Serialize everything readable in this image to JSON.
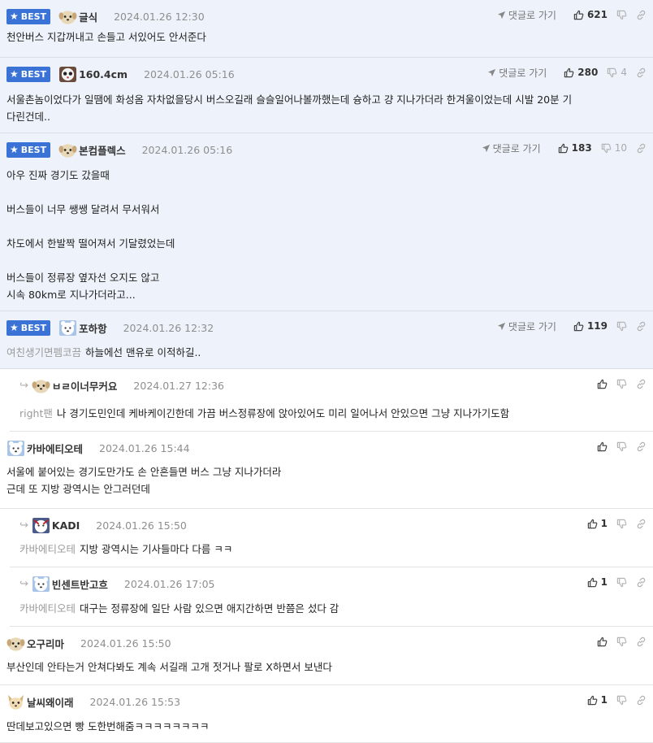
{
  "labels": {
    "best": "BEST",
    "reply_to": "댓글로 가기"
  },
  "comments": [
    {
      "nick": "글식",
      "date": "2024.01.26 12:30",
      "likes": "621",
      "dislikes": "",
      "mention": "",
      "lines": [
        "천안버스 지갑꺼내고 손들고 서있어도 안서준다"
      ]
    },
    {
      "nick": "160.4cm",
      "date": "2024.01.26 05:16",
      "likes": "280",
      "dislikes": "4",
      "mention": "",
      "lines": [
        "서울촌놈이었다가 일땜에 화성옴 자차없을당시 버스오길래 슬슬일어나볼까했는데 슝하고 걍 지나가더라 한겨울이었는데 시발 20분 기",
        "다린건데.."
      ]
    },
    {
      "nick": "본컴플렉스",
      "date": "2024.01.26 05:16",
      "likes": "183",
      "dislikes": "10",
      "mention": "",
      "lines": [
        "아우 진짜 경기도 갔을때",
        "",
        "버스들이 너무 쌩쌩 달려서 무서워서",
        "",
        "차도에서 한발짝 떨어져서 기달렸었는데",
        "",
        "버스들이 정류장 옆자선 오지도 않고",
        "시속 80km로 지나가더라고..."
      ]
    },
    {
      "nick": "포하항",
      "date": "2024.01.26 12:32",
      "likes": "119",
      "dislikes": "",
      "mention": "여친생기면펨코끔",
      "lines": [
        "하늘에선 맨유로 이적하길.."
      ]
    },
    {
      "nick": "ㅂㄹ이너무커요",
      "date": "2024.01.27 12:36",
      "likes": "",
      "dislikes": "",
      "mention": "right팬",
      "lines": [
        "나 경기도민인데 케바케이긴한데 가끔 버스정류장에 앉아있어도 미리 일어나서 안있으면 그냥 지나가기도함"
      ]
    },
    {
      "nick": "카바에티오테",
      "date": "2024.01.26 15:44",
      "likes": "",
      "dislikes": "",
      "mention": "",
      "lines": [
        "서울에 붙어있는 경기도만가도 손 안흔들면 버스 그냥 지나가더라",
        "근데 또 지방 광역시는 안그러던데"
      ]
    },
    {
      "nick": "KADI",
      "date": "2024.01.26 15:50",
      "likes": "1",
      "dislikes": "",
      "mention": "카바에티오테",
      "lines": [
        "지방 광역시는 기사들마다 다름 ㅋㅋ"
      ]
    },
    {
      "nick": "빈센트반고흐",
      "date": "2024.01.26 17:05",
      "likes": "1",
      "dislikes": "",
      "mention": "카바에티오테",
      "lines": [
        "대구는 정류장에 일단 사람 있으면 애지간하면 반쯤은 섰다 감"
      ]
    },
    {
      "nick": "오구리마",
      "date": "2024.01.26 15:50",
      "likes": "",
      "dislikes": "",
      "mention": "",
      "lines": [
        "부산인데 안타는거 안쳐다봐도 계속 서길래 고개 젓거나 팔로 X하면서 보낸다"
      ]
    },
    {
      "nick": "날씨왜이래",
      "date": "2024.01.26 15:53",
      "likes": "1",
      "dislikes": "",
      "mention": "",
      "lines": [
        "딴데보고있으면 빵 도한번해줌ㅋㅋㅋㅋㅋㅋㅋㅋ"
      ]
    }
  ],
  "colors": {
    "best_badge": "#3a72d6",
    "best_background": "#eef3fb"
  },
  "icons": {
    "reply_to": "send-arrow-icon",
    "like": "thumbs-up-icon",
    "dislike": "thumbs-down-icon",
    "link": "link-icon",
    "reply_indent": "reply-arrow-icon",
    "best": "star-icon"
  }
}
